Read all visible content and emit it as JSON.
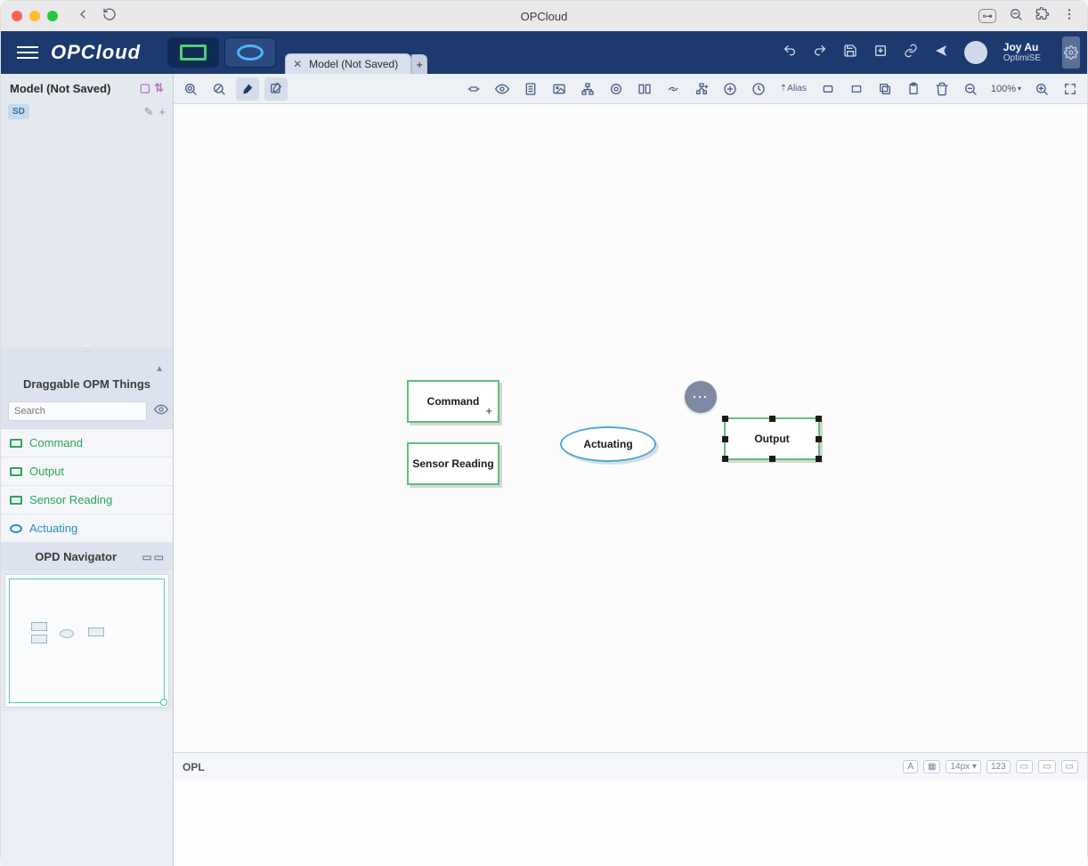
{
  "window": {
    "title": "OPCloud"
  },
  "appbar": {
    "logo": "OPCloud",
    "tab_label": "Model (Not Saved)",
    "user_name": "Joy Au",
    "user_org": "OptimiSE"
  },
  "sidebar": {
    "model_title": "Model (Not Saved)",
    "sd_badge": "SD",
    "drag_title": "Draggable OPM Things",
    "search_placeholder": "Search",
    "things": [
      {
        "label": "Command",
        "type": "object"
      },
      {
        "label": "Output",
        "type": "object"
      },
      {
        "label": "Sensor Reading",
        "type": "object"
      },
      {
        "label": "Actuating",
        "type": "process"
      }
    ],
    "opd_nav_title": "OPD Navigator"
  },
  "toolbar": {
    "alias_label": "Alias",
    "zoom": "100%"
  },
  "canvas": {
    "nodes": {
      "command": "Command",
      "sensor": "Sensor Reading",
      "actuating": "Actuating",
      "output": "Output"
    }
  },
  "opl": {
    "label": "OPL",
    "font_size": "14px"
  }
}
